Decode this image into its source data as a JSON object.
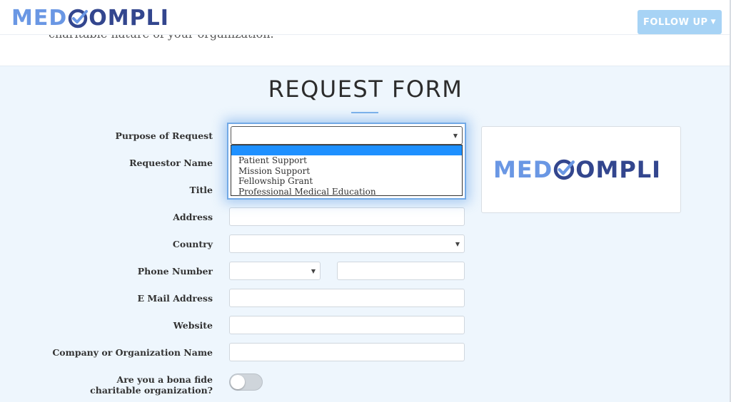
{
  "header": {
    "logo": {
      "part1": "MED",
      "part2": "OMPLI"
    },
    "follow_button": "FOLLOW UP"
  },
  "intro": {
    "text": "charitable nature of your organization."
  },
  "form": {
    "title": "REQUEST FORM",
    "fields": {
      "purpose": {
        "label": "Purpose of Request",
        "value": ""
      },
      "requestor_name": {
        "label": "Requestor Name"
      },
      "title": {
        "label": "Title"
      },
      "address": {
        "label": "Address",
        "value": ""
      },
      "country": {
        "label": "Country",
        "value": ""
      },
      "phone": {
        "label": "Phone Number",
        "code": "",
        "number": ""
      },
      "email": {
        "label": "E Mail Address",
        "value": ""
      },
      "website": {
        "label": "Website",
        "value": ""
      },
      "company": {
        "label": "Company or Organization Name",
        "value": ""
      },
      "charitable": {
        "label": "Are you a bona fide charitable organization?",
        "value": "off"
      }
    },
    "purpose_options": [
      "",
      "Patient Support",
      "Mission Support",
      "Fellowship Grant",
      "Professional Medical Education"
    ]
  },
  "logo_card": {
    "part1": "MED",
    "part2": "OMPLI"
  },
  "colors": {
    "logo_light": "#6a97e4",
    "logo_dark": "#33468e",
    "accent": "#a7d3f5",
    "highlight": "#1e90ff"
  }
}
